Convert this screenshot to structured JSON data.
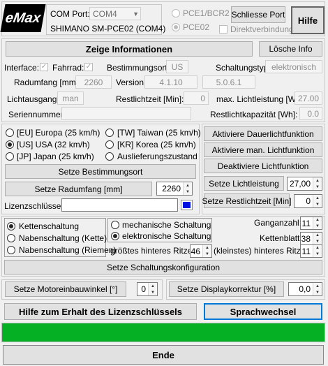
{
  "header": {
    "logo_text": "eMax",
    "com_port_label": "COM Port:",
    "com_port_value": "COM4",
    "device_name": "SHIMANO SM-PCE02 (COM4)",
    "pce1_label": "PCE1/BCR2",
    "pce02_label": "PCE02",
    "close_port_label": "Schliesse Port",
    "direct_label": "Direktverbindung",
    "help_label": "Hilfe"
  },
  "info": {
    "show_info_label": "Zeige Informationen",
    "clear_info_label": "Lösche Info",
    "interface_label": "Interface:",
    "bike_label": "Fahrrad:",
    "destination_label": "Bestimmungsort:",
    "destination_value": "US",
    "shift_type_label": "Schaltungstyp:",
    "shift_type_value": "elektronisch",
    "wheel_label": "Radumfang [mm]:",
    "wheel_value": "2260",
    "version_label": "Version:",
    "version_value": "4.1.10",
    "version2_value": "5.0.6.1",
    "light_output_label": "Lichtausgang:",
    "light_output_value": "man",
    "remaining_time_label": "Restlichtzeit [Min]:",
    "remaining_time_value": "0",
    "max_light_label": "max. Lichtleistung [W]:",
    "max_light_value": "27.00",
    "serial_label": "Seriennummer:",
    "remaining_capacity_label": "Restlichtkapazität [Wh]:",
    "remaining_capacity_value": "0.0"
  },
  "regions": {
    "eu": "[EU] Europa (25 km/h)",
    "us": "[US] USA (32 km/h)",
    "jp": "[JP] Japan (25 km/h)",
    "tw": "[TW] Taiwan (25 km/h)",
    "kr": "[KR] Korea (25 km/h)",
    "factory": "Auslieferungszustand",
    "set_destination": "Setze Bestimmungsort",
    "set_wheel": "Setze Radumfang [mm]",
    "wheel_input": "2260",
    "license_label": "Lizenzschlüssel:"
  },
  "light": {
    "continuous_on": "Aktiviere Dauerlichtfunktion",
    "manual_on": "Aktiviere man. Lichtfunktion",
    "deactivate": "Deaktiviere Lichtfunktion",
    "set_power": "Setze Lichtleistung",
    "power_value": "27,00",
    "set_remaining": "Setze Restlichtzeit [Min]",
    "remaining_value": "0"
  },
  "shifting": {
    "derailleur": "Kettenschaltung",
    "hub_chain": "Nabenschaltung (Kette)",
    "hub_belt": "Nabenschaltung (Riemen)",
    "mechanical": "mechanische Schaltung",
    "electronic": "elektronische Schaltung",
    "gear_count_label": "Ganganzahl:",
    "gear_count_value": "11",
    "chainring_label": "Kettenblatt:",
    "chainring_value": "38",
    "largest_label": "größtes hinteres Ritzel:",
    "largest_value": "46",
    "smallest_label": "(kleinstes) hinteres Ritzel:",
    "smallest_value": "11",
    "set_config": "Setze Schaltungskonfiguration"
  },
  "bottom": {
    "motor_angle_label": "Setze Motoreinbauwinkel [°]",
    "motor_angle_value": "0",
    "display_corr_label": "Setze Displaykorrektur [%]",
    "display_corr_value": "0,0",
    "license_help": "Hilfe zum Erhalt des Lizenzschlüssels",
    "language": "Sprachwechsel",
    "progress": 1.0,
    "end": "Ende"
  },
  "colors": {
    "progress_green": "#06b025",
    "accent_blue": "#0078d7",
    "license_swatch": "#0010e0"
  }
}
